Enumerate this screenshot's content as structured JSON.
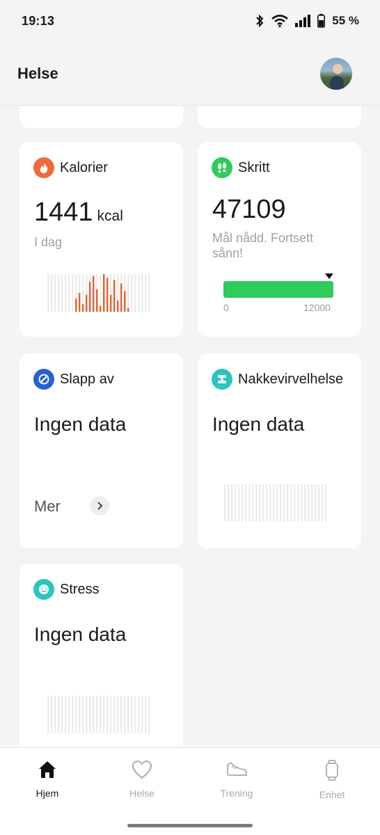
{
  "status_bar": {
    "time": "19:13",
    "battery": "55 %",
    "icons": [
      "bluetooth-icon",
      "wifi-icon",
      "signal-icon",
      "battery-icon"
    ]
  },
  "header": {
    "title": "Helse"
  },
  "cards": {
    "kalorier": {
      "title": "Kalorier",
      "value": "1441",
      "unit": "kcal",
      "subtitle": "I dag",
      "icon": "flame-icon",
      "icon_color": "#f06a3a",
      "bar_color": "#e0622f",
      "bars": [
        0,
        0,
        0,
        0,
        0,
        0,
        0,
        0,
        0.35,
        0.5,
        0.2,
        0.45,
        0.8,
        0.95,
        0.6,
        0.15,
        1.0,
        0.9,
        0.45,
        0.85,
        0.3,
        0.75,
        0.55,
        0.1,
        0,
        0,
        0,
        0,
        0,
        0
      ]
    },
    "skritt": {
      "title": "Skritt",
      "value": "47109",
      "subtitle": "Mål nådd. Fortsett sånn!",
      "icon": "footprints-icon",
      "icon_color": "#2ecc5a",
      "progress_color": "#2ecc5a",
      "goal_progress": 1.0,
      "scale_min": "0",
      "scale_max": "12000"
    },
    "slapp_av": {
      "title": "Slapp av",
      "value": "Ingen data",
      "more_label": "Mer",
      "icon": "relax-icon",
      "icon_color": "#2a5fd6"
    },
    "nakke": {
      "title": "Nakkevirvelhelse",
      "value": "Ingen data",
      "icon": "neck-icon",
      "icon_color": "#2cc4c0"
    },
    "stress": {
      "title": "Stress",
      "value": "Ingen data",
      "icon": "smiley-icon",
      "icon_color": "#2cc4c0"
    }
  },
  "nav": {
    "items": [
      {
        "label": "Hjem",
        "icon": "home-icon",
        "active": true
      },
      {
        "label": "Helse",
        "icon": "heart-icon",
        "active": false
      },
      {
        "label": "Trening",
        "icon": "shoe-icon",
        "active": false
      },
      {
        "label": "Enhet",
        "icon": "watch-icon",
        "active": false
      }
    ]
  }
}
